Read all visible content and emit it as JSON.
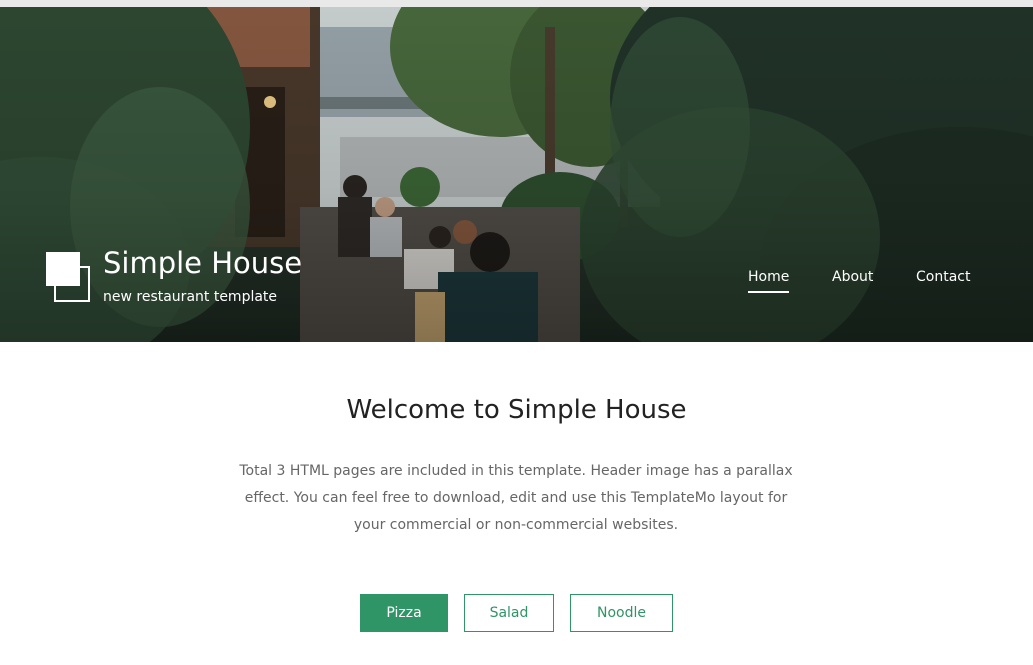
{
  "header": {
    "site_title": "Simple House",
    "tagline": "new restaurant template",
    "nav": [
      {
        "label": "Home",
        "active": true
      },
      {
        "label": "About",
        "active": false
      },
      {
        "label": "Contact",
        "active": false
      }
    ],
    "logo_icon": "overlapping-squares-icon"
  },
  "main": {
    "heading": "Welcome to Simple House",
    "description": "Total 3 HTML pages are included in this template. Header image has a parallax effect. You can feel free to download, edit and use this TemplateMo layout for your commercial or non-commercial websites.",
    "tabs": [
      {
        "label": "Pizza",
        "active": true
      },
      {
        "label": "Salad",
        "active": false
      },
      {
        "label": "Noodle",
        "active": false
      }
    ]
  },
  "colors": {
    "accent": "#2f9466",
    "text_dark": "#222222",
    "text_muted": "#666666",
    "header_overlay": "#2c3a30"
  }
}
